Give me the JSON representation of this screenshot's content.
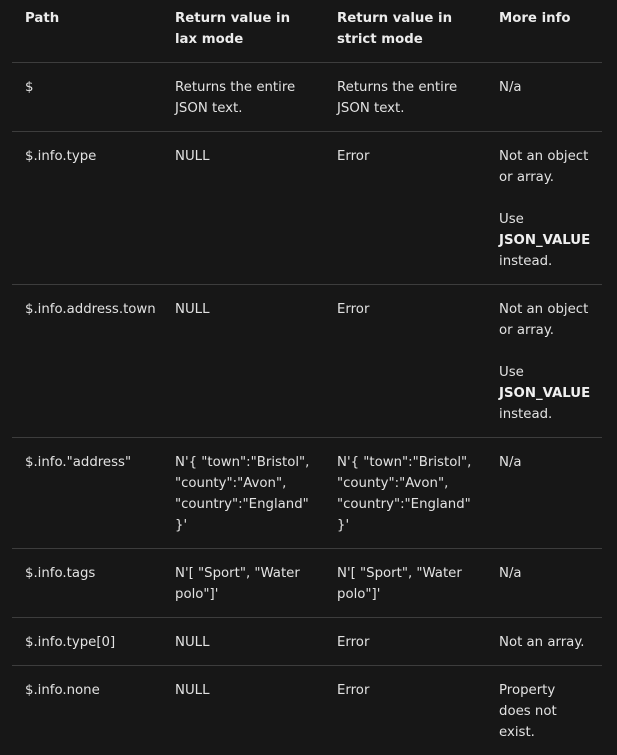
{
  "headers": {
    "path": "Path",
    "lax": "Return value in lax mode",
    "strict": "Return value in strict mode",
    "info": "More info"
  },
  "rows": [
    {
      "path": "$",
      "lax": "Returns the entire JSON text.",
      "strict": "Returns the entire JSON text.",
      "info_1": "N/a"
    },
    {
      "path": "$.info.type",
      "lax": "NULL",
      "strict": "Error",
      "info_1": "Not an object or array.",
      "info_2_pre": "Use",
      "info_2_code": "JSON_VALUE",
      "info_2_post": "instead."
    },
    {
      "path": "$.info.address.town",
      "lax": "NULL",
      "strict": "Error",
      "info_1": "Not an object or array.",
      "info_2_pre": "Use",
      "info_2_code": "JSON_VALUE",
      "info_2_post": "instead."
    },
    {
      "path": "$.info.\"address\"",
      "lax": "N'{ \"town\":\"Bristol\", \"county\":\"Avon\", \"country\":\"England\" }'",
      "strict": "N'{ \"town\":\"Bristol\", \"county\":\"Avon\", \"country\":\"England\" }'",
      "info_1": "N/a"
    },
    {
      "path": "$.info.tags",
      "lax": "N'[ \"Sport\", \"Water polo\"]'",
      "strict": "N'[ \"Sport\", \"Water polo\"]'",
      "info_1": "N/a"
    },
    {
      "path": "$.info.type[0]",
      "lax": "NULL",
      "strict": "Error",
      "info_1": "Not an array."
    },
    {
      "path": "$.info.none",
      "lax": "NULL",
      "strict": "Error",
      "info_1": "Property does not exist."
    }
  ],
  "colors": {
    "background": "#171717",
    "text": "#e2e2e2",
    "divider": "#3d3d3d"
  }
}
